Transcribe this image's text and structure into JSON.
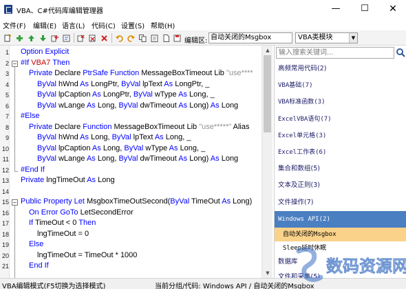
{
  "window": {
    "title": "VBA、C#代码库编辑管理器",
    "minimize_glyph": "—",
    "maximize_glyph": "☐",
    "close_glyph": "✕"
  },
  "menu": [
    "文件(F)",
    "编辑(E)",
    "语言(L)",
    "代码(C)",
    "设置(S)",
    "帮助(H)"
  ],
  "toolbar": {
    "icons": [
      "new-file-icon",
      "add-green-icon",
      "arrow-up-icon",
      "arrow-down-icon",
      "add-code-icon",
      "rename-icon",
      "delete-red-icon",
      "delete-icon",
      "delete-x-icon",
      "undo-icon",
      "redo-icon",
      "copy-icon",
      "paste-icon",
      "document-icon",
      "save-icon"
    ],
    "edit_area_label": "编辑区:",
    "edit_area_value": "自动关闭的Msgbox",
    "module_select": "VBA类模块",
    "accent": "#1b3f86"
  },
  "editor": {
    "line_numbers": [
      "1",
      "2",
      "3",
      "4",
      "5",
      "6",
      "7",
      "8",
      "9",
      "10",
      "11",
      "12",
      "13",
      "14",
      "15",
      "16",
      "17",
      "18",
      "19",
      "20",
      "21"
    ],
    "lines": [
      [
        [
          "kw",
          "Option Explicit"
        ]
      ],
      [
        [
          "kw",
          "#If "
        ],
        [
          "red",
          "VBA7"
        ],
        [
          "kw",
          " Then"
        ]
      ],
      [
        [
          "kw",
          "Private "
        ],
        [
          "txt",
          "Declare "
        ],
        [
          "kw",
          "PtrSafe Function "
        ],
        [
          "txt",
          "MessageBoxTimeout Lib "
        ],
        [
          "str",
          "\"use****"
        ]
      ],
      [
        [
          "kw",
          "ByVal "
        ],
        [
          "txt",
          "hWnd "
        ],
        [
          "kw",
          "As "
        ],
        [
          "txt",
          "LongPtr, "
        ],
        [
          "kw",
          "ByVal "
        ],
        [
          "txt",
          "lpText "
        ],
        [
          "kw",
          "As "
        ],
        [
          "txt",
          "LongPtr, _"
        ]
      ],
      [
        [
          "kw",
          "ByVal "
        ],
        [
          "txt",
          "lpCaption "
        ],
        [
          "kw",
          "As "
        ],
        [
          "txt",
          "LongPtr, "
        ],
        [
          "kw",
          "ByVal "
        ],
        [
          "txt",
          "wType "
        ],
        [
          "kw",
          "As "
        ],
        [
          "txt",
          "Long, _"
        ]
      ],
      [
        [
          "kw",
          "ByVal "
        ],
        [
          "txt",
          "wLange "
        ],
        [
          "kw",
          "As "
        ],
        [
          "txt",
          "Long, "
        ],
        [
          "kw",
          "ByVal "
        ],
        [
          "txt",
          "dwTimeout "
        ],
        [
          "kw",
          "As "
        ],
        [
          "txt",
          "Long) "
        ],
        [
          "kw",
          "As "
        ],
        [
          "txt",
          "Long"
        ]
      ],
      [
        [
          "kw",
          "#Else"
        ]
      ],
      [
        [
          "kw",
          "Private "
        ],
        [
          "txt",
          "Declare "
        ],
        [
          "kw",
          "Function "
        ],
        [
          "txt",
          "MessageBoxTimeout Lib "
        ],
        [
          "str",
          "\"use*****\" "
        ],
        [
          "txt",
          "Alias"
        ]
      ],
      [
        [
          "kw",
          "ByVal "
        ],
        [
          "txt",
          "hWnd "
        ],
        [
          "kw",
          "As "
        ],
        [
          "txt",
          "Long, "
        ],
        [
          "kw",
          "ByVal "
        ],
        [
          "txt",
          "lpText "
        ],
        [
          "kw",
          "As "
        ],
        [
          "txt",
          "Long, _"
        ]
      ],
      [
        [
          "kw",
          "ByVal "
        ],
        [
          "txt",
          "lpCaption "
        ],
        [
          "kw",
          "As "
        ],
        [
          "txt",
          "Long, "
        ],
        [
          "kw",
          "ByVal "
        ],
        [
          "txt",
          "wType "
        ],
        [
          "kw",
          "As "
        ],
        [
          "txt",
          "Long, _"
        ]
      ],
      [
        [
          "kw",
          "ByVal "
        ],
        [
          "txt",
          "wLange "
        ],
        [
          "kw",
          "As "
        ],
        [
          "txt",
          "Long, "
        ],
        [
          "kw",
          "ByVal "
        ],
        [
          "txt",
          "dwTimeout "
        ],
        [
          "kw",
          "As "
        ],
        [
          "txt",
          "Long) "
        ],
        [
          "kw",
          "As "
        ],
        [
          "txt",
          "Long"
        ]
      ],
      [
        [
          "kw",
          "#End If"
        ]
      ],
      [
        [
          "kw",
          "Private "
        ],
        [
          "txt",
          "lngTimeOut "
        ],
        [
          "kw",
          "As "
        ],
        [
          "txt",
          "Long"
        ]
      ],
      [],
      [
        [
          "kw",
          "Public Property Let "
        ],
        [
          "txt",
          "MsgboxTimeOutSecond("
        ],
        [
          "kw",
          "ByVal "
        ],
        [
          "txt",
          "TimeOut "
        ],
        [
          "kw",
          "As "
        ],
        [
          "txt",
          "Long)"
        ]
      ],
      [
        [
          "kw",
          "On Error GoTo "
        ],
        [
          "txt",
          "LetSecondError"
        ]
      ],
      [
        [
          "kw",
          "If "
        ],
        [
          "txt",
          "TimeOut < 0 "
        ],
        [
          "kw",
          "Then"
        ]
      ],
      [
        [
          "txt",
          "lngTimeOut = 0"
        ]
      ],
      [
        [
          "kw",
          "Else"
        ]
      ],
      [
        [
          "txt",
          "lngTimeOut = TimeOut * 1000"
        ]
      ],
      [
        [
          "kw",
          "End If"
        ]
      ]
    ]
  },
  "panel": {
    "search_placeholder": "输入搜索关键词...",
    "categories": [
      {
        "label": "高频常用代码(2)",
        "mono": false
      },
      {
        "label": "VBA基础(7)",
        "mono": true
      },
      {
        "label": "VBA标准函数(3)",
        "mono": true
      },
      {
        "label": "ExcelVBA语句(7)",
        "mono": true
      },
      {
        "label": "Excel单元格(3)",
        "mono": true
      },
      {
        "label": "Excel工作表(6)",
        "mono": true
      },
      {
        "label": "集合和数组(5)",
        "mono": false
      },
      {
        "label": "文本及正则(3)",
        "mono": false
      },
      {
        "label": "文件操作(7)",
        "mono": false
      },
      {
        "label": "Windows API(2)",
        "mono": true,
        "selected": true
      }
    ],
    "sub_items": [
      {
        "label": "自动关闭的Msgbox",
        "highlight": true
      },
      {
        "label": "Sleep延时休眠",
        "highlight": false
      }
    ],
    "partial_items": [
      "数据库",
      "文件和采集(5)"
    ],
    "selected_color": "#4a7fc1",
    "highlight_color": "#fbd28a"
  },
  "status": {
    "mode": "VBA编辑模式(F5切换为选择模式)",
    "current_label": "当前分组/代码: ",
    "current_value": "Windows API / 自动关闭的Msgbox"
  },
  "watermark": {
    "text": "数码资源网"
  }
}
